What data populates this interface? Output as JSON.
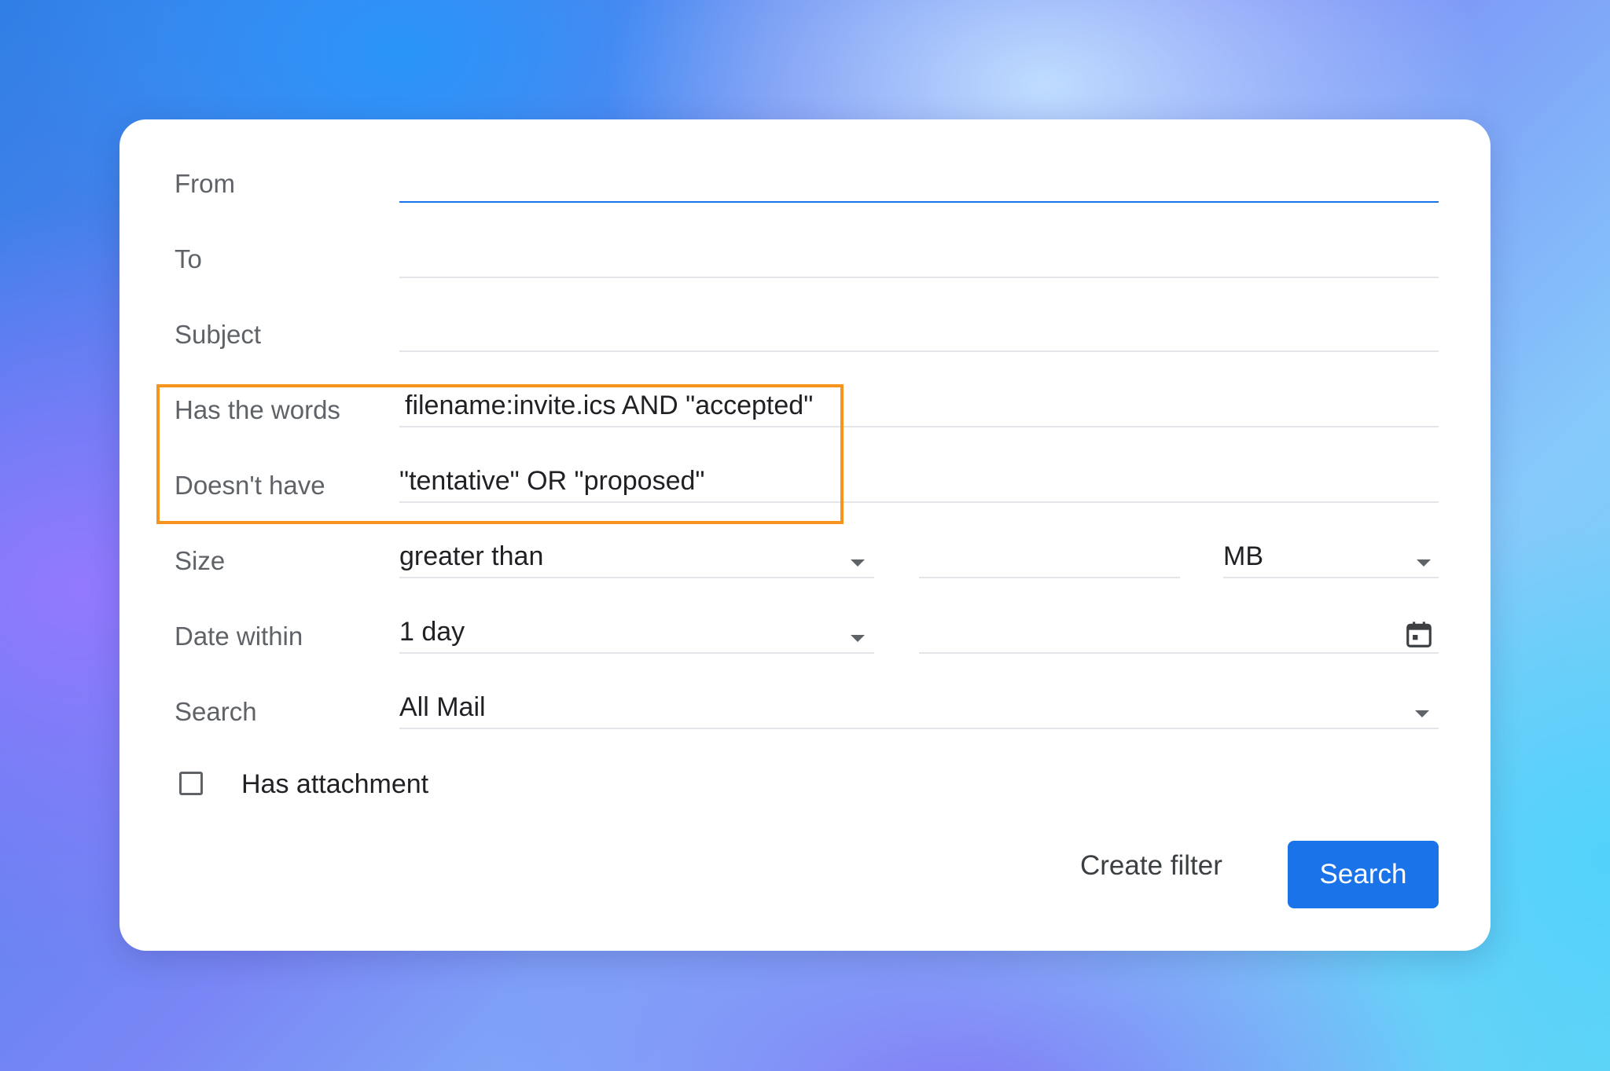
{
  "dialog": {
    "rows": {
      "from": {
        "label": "From",
        "value": ""
      },
      "to": {
        "label": "To",
        "value": ""
      },
      "subject": {
        "label": "Subject",
        "value": ""
      },
      "has_words": {
        "label": "Has the words",
        "value": "filename:invite.ics AND \"accepted\""
      },
      "doesnt_have": {
        "label": "Doesn't have",
        "value": "\"tentative\" OR \"proposed\""
      },
      "size": {
        "label": "Size",
        "operator": "greater than",
        "amount": "",
        "unit": "MB"
      },
      "date_within": {
        "label": "Date within",
        "value": "1 day",
        "date": ""
      },
      "search": {
        "label": "Search",
        "value": "All Mail"
      }
    },
    "has_attachment": {
      "label": "Has attachment",
      "checked": false
    },
    "buttons": {
      "create_filter": "Create filter",
      "search": "Search"
    }
  },
  "icons": {
    "dropdown": "chevron-down-icon",
    "calendar": "calendar-icon"
  },
  "colors": {
    "primary": "#1a73e8",
    "highlight": "#f7941d",
    "label": "#5f6368",
    "text": "#202124"
  }
}
